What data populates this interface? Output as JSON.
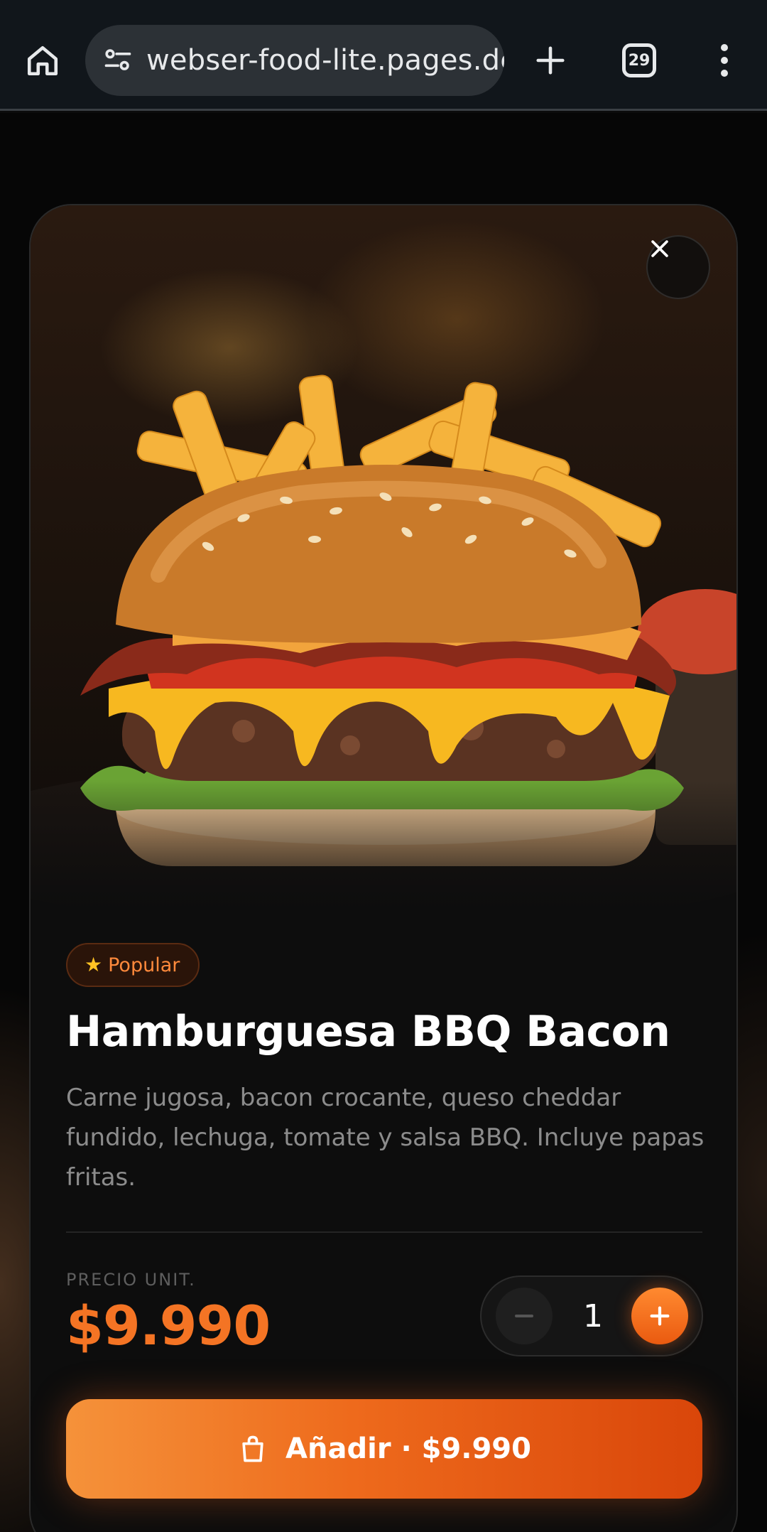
{
  "browser": {
    "url": "webser-food-lite.pages.dev",
    "tab_count": "29"
  },
  "product": {
    "badge": "Popular",
    "title": "Hamburguesa BBQ Bacon",
    "description": "Carne jugosa, bacon crocante, queso cheddar fundido, lechuga, tomate y salsa BBQ. Incluye papas fritas.",
    "price_label": "PRECIO UNIT.",
    "price": "$9.990",
    "quantity": "1",
    "add_button_label": "Añadir · $9.990"
  },
  "icons": [
    "home-icon",
    "site-settings-icon",
    "new-tab-icon",
    "tabs-icon",
    "more-menu-icon",
    "close-icon",
    "star-icon",
    "minus-icon",
    "plus-icon",
    "shopping-bag-icon"
  ],
  "colors": {
    "accent": "#f47424",
    "badge_text": "#ff8a3c",
    "card_bg": "#0d0d0d"
  }
}
